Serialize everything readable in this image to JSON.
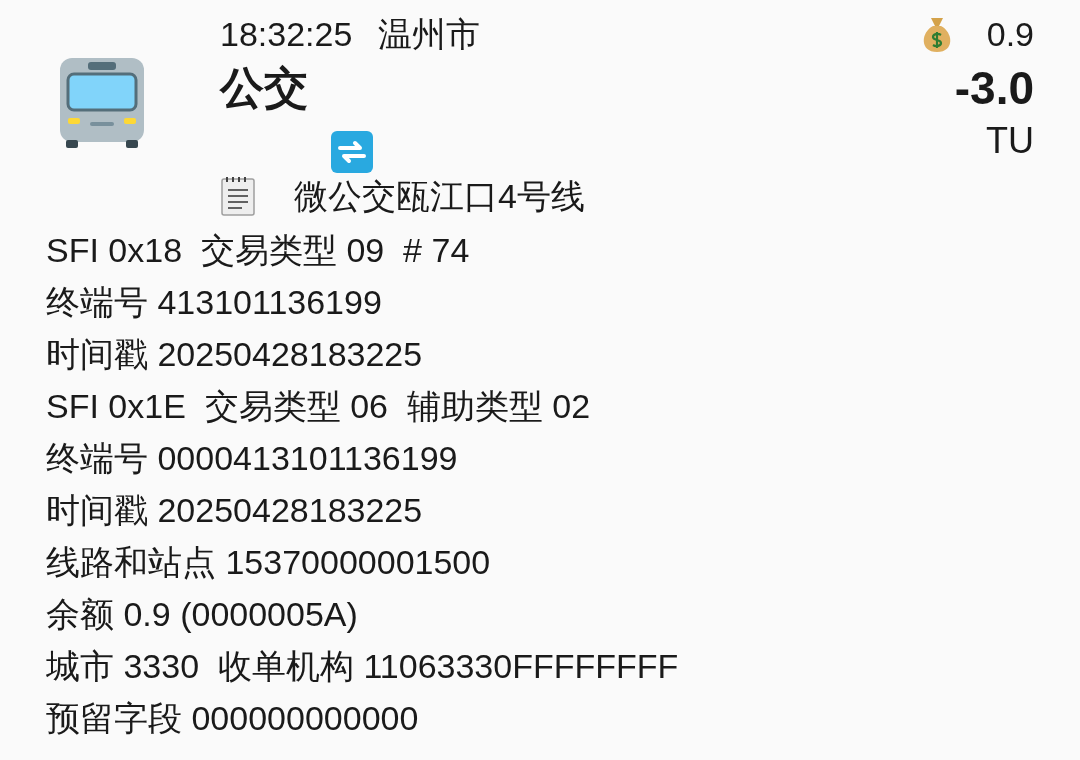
{
  "header": {
    "time": "18:32:25",
    "city": "温州市",
    "title": "公交",
    "route": "微公交瓯江口4号线"
  },
  "summary": {
    "balance": "0.9",
    "amount": "-3.0",
    "unit": "TU"
  },
  "lines": [
    "SFI 0x18  交易类型 09  # 74",
    "终端号 413101136199",
    "时间戳 20250428183225",
    "SFI 0x1E  交易类型 06  辅助类型 02",
    "终端号 0000413101136199",
    "时间戳 20250428183225",
    "线路和站点 15370000001500",
    "余额 0.9 (0000005A)",
    "城市 3330  收单机构 11063330FFFFFFFF",
    "预留字段 000000000000"
  ]
}
